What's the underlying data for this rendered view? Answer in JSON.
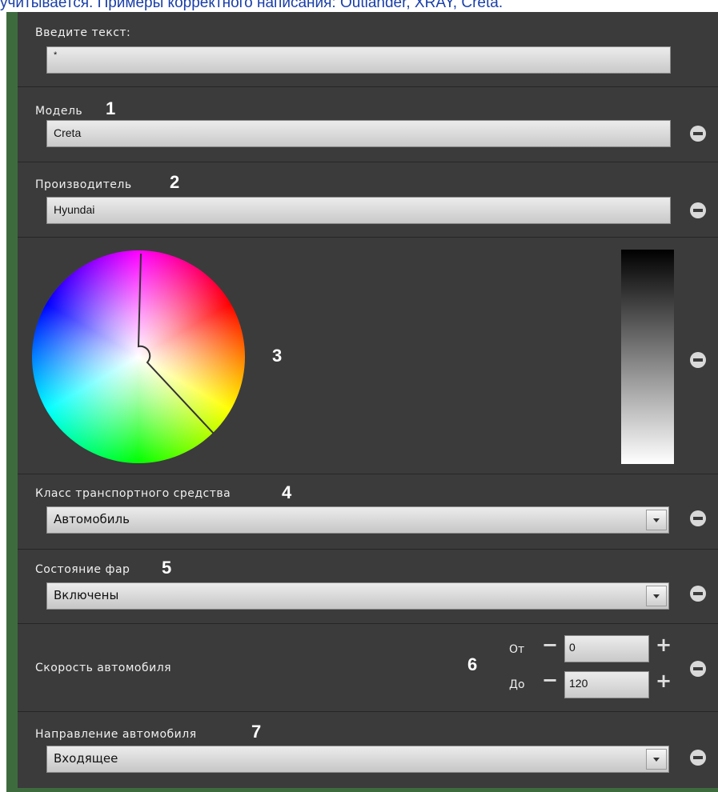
{
  "caption": "учитывается. Примеры корректного написания: Outlander, XRAY, Creta.",
  "text_row": {
    "label": "Введите текст:",
    "value": "*"
  },
  "model_row": {
    "label": "Модель",
    "number": "1",
    "value": "Creta"
  },
  "maker_row": {
    "label": "Производитель",
    "number": "2",
    "value": "Hyundai"
  },
  "color_row": {
    "number": "3"
  },
  "class_row": {
    "label": "Класс транспортного средства",
    "number": "4",
    "value": "Автомобиль"
  },
  "lights_row": {
    "label": "Состояние фар",
    "number": "5",
    "value": "Включены"
  },
  "speed_row": {
    "label": "Скорость автомобиля",
    "number": "6",
    "from_label": "От",
    "from_value": "0",
    "to_label": "До",
    "to_value": "120",
    "minus": "−",
    "plus": "+"
  },
  "direction_row": {
    "label": "Направление автомобиля",
    "number": "7",
    "value": "Входящее"
  },
  "icons": {
    "remove": "minus-circle-icon",
    "dropdown": "chevron-down-icon"
  },
  "colors": {
    "panel": "#3b3b3b",
    "frame": "#3e6b3e",
    "caption": "#1a3fa8"
  }
}
